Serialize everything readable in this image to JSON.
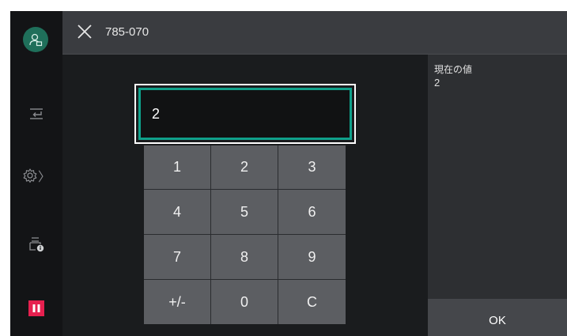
{
  "header": {
    "title": "785-070",
    "close_icon": "close-icon"
  },
  "sidebar": {
    "items": [
      {
        "name": "user-avatar",
        "icon": "user-icon"
      },
      {
        "name": "sign-in",
        "icon": "import-icon"
      },
      {
        "name": "settings",
        "icon": "gear-icon"
      },
      {
        "name": "device-info",
        "icon": "printer-info-icon"
      },
      {
        "name": "pause",
        "icon": "pause-icon"
      }
    ],
    "chevron": "〉"
  },
  "input": {
    "value": "2"
  },
  "keypad": {
    "keys": [
      "1",
      "2",
      "3",
      "4",
      "5",
      "6",
      "7",
      "8",
      "9",
      "+/-",
      "0",
      "C"
    ]
  },
  "panel": {
    "current_label": "現在の値",
    "current_value": "2",
    "ok_label": "OK"
  },
  "colors": {
    "accent": "#0fa08a",
    "pause": "#e6204f",
    "avatar": "#1f6f5a"
  }
}
